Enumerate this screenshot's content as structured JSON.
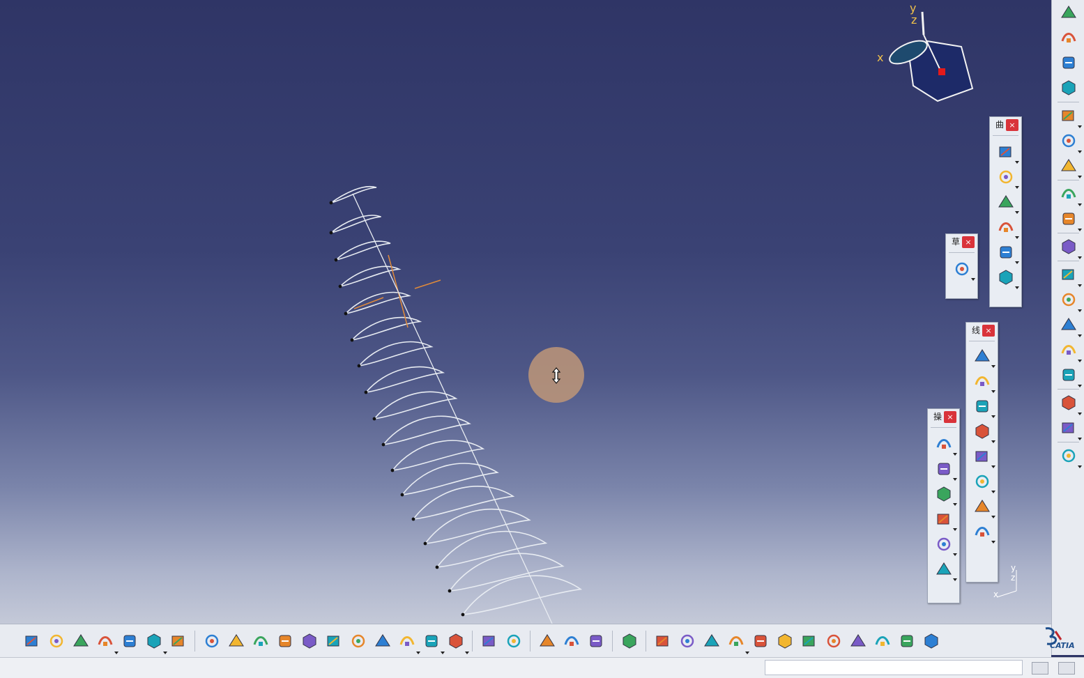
{
  "app": {
    "name": "CATIA"
  },
  "colors": {
    "background_top": "#2f3566",
    "background_bottom": "#c4c9d8",
    "curve": "#e8ecf2",
    "guide": "#e08a3a",
    "close_button": "#d9333a",
    "axis_label": "#f0c14a"
  },
  "compass": {
    "x_label": "x",
    "y_label": "y",
    "z_label": "z"
  },
  "mini_axis": {
    "x_label": "x",
    "y_label": "y",
    "z_label": "z"
  },
  "floating_toolbars": [
    {
      "title": "曲",
      "close": "×",
      "tools": [
        "sweep-icon",
        "multi-section-surface-icon",
        "fill-icon",
        "blend-icon",
        "offset-icon",
        "extrude-surface-icon"
      ]
    },
    {
      "title": "草",
      "close": "×",
      "tools": [
        "sketch-icon"
      ]
    },
    {
      "title": "线",
      "close": "×",
      "tools": [
        "point-icon",
        "line-icon",
        "plane-icon",
        "projection-icon",
        "intersection-icon",
        "spline-icon",
        "circle-icon",
        "connect-curve-icon"
      ]
    },
    {
      "title": "操",
      "close": "×",
      "tools": [
        "join-icon",
        "split-icon",
        "trim-icon",
        "boundary-icon",
        "extract-icon",
        "fillet-icon"
      ]
    }
  ],
  "right_toolbar_tools": [
    "product-icon",
    "part-icon",
    "assembly-icon",
    "document-icon",
    "users-icon",
    "tree-icon",
    "knowledge-icon",
    "select-arrow-icon",
    "explode-icon",
    "law-curve-icon",
    "repetition-icon",
    "grid-icon",
    "catalog-icon",
    "layers-icon",
    "analysis-icon",
    "material-icon",
    "measure-icon",
    "tools-icon"
  ],
  "bottom_toolbar_tools": [
    "formula-icon",
    "comment-icon",
    "check-icon",
    "table-icon",
    "graph-icon",
    "lock-icon",
    "parameters-icon",
    "fly-icon",
    "fit-all-icon",
    "pan-icon",
    "rotate-icon",
    "zoom-in-icon",
    "zoom-out-icon",
    "normal-view-icon",
    "multi-view-icon",
    "iso-view-icon",
    "shading-icon",
    "hide-show-icon",
    "swap-icon",
    "update-icon",
    "measure-between-icon",
    "apply-material-icon",
    "mass-icon",
    "capture-icon",
    "reorder-icon",
    "hand-icon",
    "axis-system-icon",
    "work-on-support-icon",
    "grid-snap-icon",
    "snap-icon",
    "fix-icon",
    "constraint-icon",
    "bodies-icon",
    "structure-icon",
    "hide-icon",
    "more-icon"
  ],
  "status": {
    "input_value": ""
  },
  "logo": {
    "text": "CATIA"
  }
}
